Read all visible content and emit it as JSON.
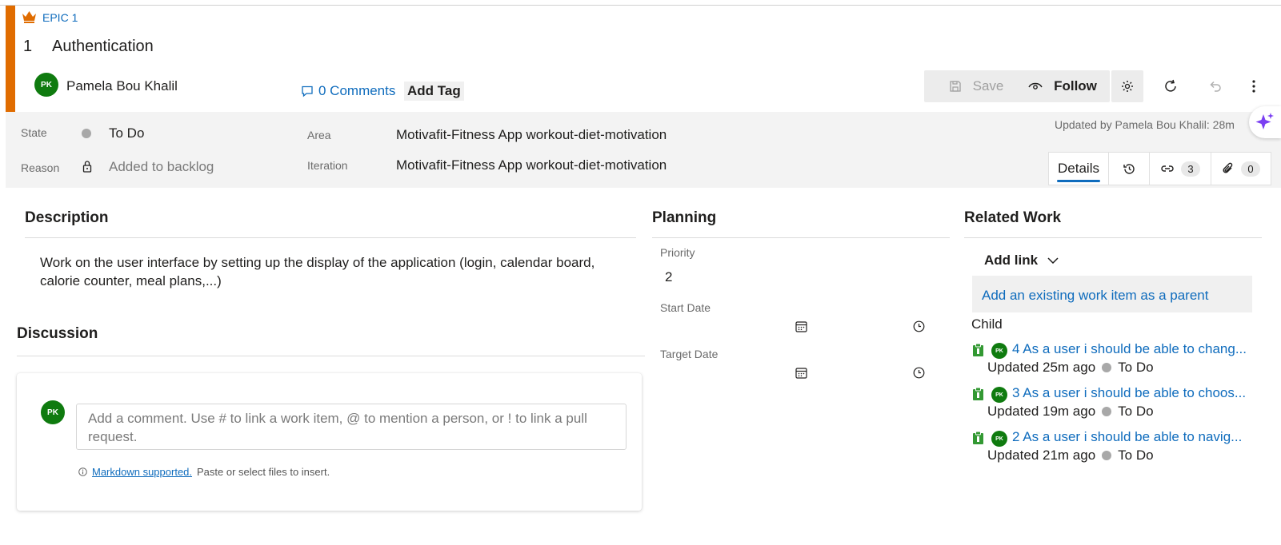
{
  "header": {
    "epic_label": "EPIC 1",
    "id": "1",
    "title": "Authentication",
    "assignee": {
      "name": "Pamela Bou Khalil",
      "initials": "PK"
    },
    "comments_label": "0 Comments",
    "add_tag_label": "Add Tag",
    "save_label": "Save",
    "follow_label": "Follow",
    "updated_by": "Updated by Pamela Bou Khalil: 28m",
    "accent_color": "#e06c00"
  },
  "fields": {
    "state": {
      "label": "State",
      "value": "To Do"
    },
    "reason": {
      "label": "Reason",
      "value": "Added to backlog"
    },
    "area": {
      "label": "Area",
      "value": "Motivafit-Fitness App workout-diet-motivation"
    },
    "iteration": {
      "label": "Iteration",
      "value": "Motivafit-Fitness App workout-diet-motivation"
    }
  },
  "tabs": {
    "details_label": "Details",
    "links_count": "3",
    "attachments_count": "0"
  },
  "description": {
    "title": "Description",
    "text": "Work on the user interface by setting up the display of the application (login, calendar board, calorie counter, meal plans,...)"
  },
  "discussion": {
    "title": "Discussion",
    "avatar_initials": "PK",
    "placeholder": "Add a comment. Use # to link a work item, @ to mention a person, or ! to link a pull request.",
    "markdown_link": "Markdown supported.",
    "markdown_note": "Paste or select files to insert."
  },
  "planning": {
    "title": "Planning",
    "priority_label": "Priority",
    "priority_value": "2",
    "start_date_label": "Start Date",
    "target_date_label": "Target Date"
  },
  "related": {
    "title": "Related Work",
    "add_link_label": "Add link",
    "parent_link_label": "Add an existing work item as a parent",
    "child_label": "Child",
    "children": [
      {
        "id": "4",
        "title": "As a user i should be able to chang...",
        "updated": "Updated 25m ago",
        "state": "To Do",
        "initials": "PK"
      },
      {
        "id": "3",
        "title": "As a user i should be able to choos...",
        "updated": "Updated 19m ago",
        "state": "To Do",
        "initials": "PK"
      },
      {
        "id": "2",
        "title": "As a user i should be able to navig...",
        "updated": "Updated 21m ago",
        "state": "To Do",
        "initials": "PK"
      }
    ]
  }
}
